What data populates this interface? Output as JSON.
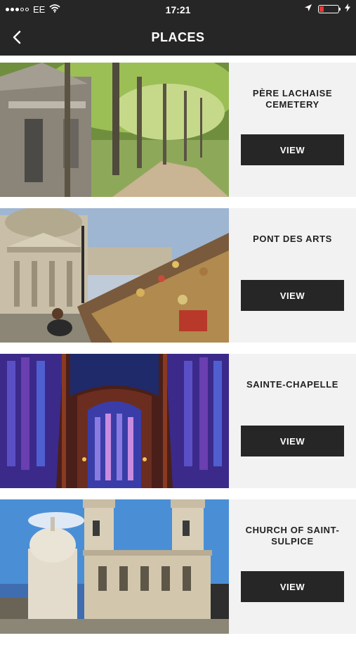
{
  "status_bar": {
    "carrier": "EE",
    "time": "17:21",
    "signal_icon": "signal-dots-icon",
    "wifi_icon": "wifi-icon",
    "location_icon": "location-arrow-icon",
    "battery_icon": "battery-low-icon",
    "charging_icon": "charging-bolt-icon",
    "battery_color": "#e53935"
  },
  "header": {
    "title": "PLACES",
    "back_icon": "chevron-left-icon",
    "background": "#262626"
  },
  "places": [
    {
      "name": "PÈRE LACHAISE CEMETERY",
      "button_label": "VIEW"
    },
    {
      "name": "PONT DES ARTS",
      "button_label": "VIEW"
    },
    {
      "name": "SAINTE-CHAPELLE",
      "button_label": "VIEW"
    },
    {
      "name": "CHURCH OF SAINT-SULPICE",
      "button_label": "VIEW"
    }
  ]
}
